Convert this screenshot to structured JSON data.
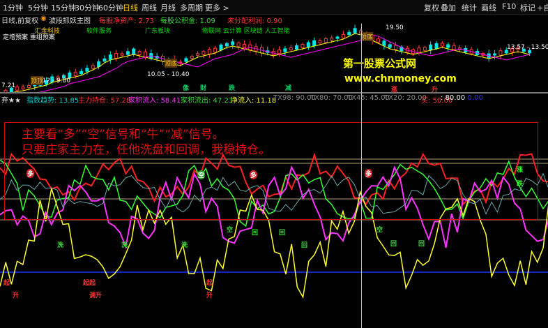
{
  "toolbar": {
    "periods": [
      "1分钟",
      "5分钟",
      "15分钟",
      "30分钟",
      "60分钟",
      "日线",
      "周线",
      "月线",
      "多周期",
      "更多 >"
    ],
    "active_period": "日线",
    "right": [
      "复权",
      "叠加",
      "统计",
      "画线",
      "F10",
      "标记",
      "+自"
    ]
  },
  "infobar": {
    "chart_label": "日线,前复权",
    "formula": "波段抓妖主图",
    "stats": [
      {
        "text": "每股净资产: 2.73",
        "color": "#ff3333"
      },
      {
        "text": "每股公积金: 1.09",
        "color": "#33dd33"
      },
      {
        "text": "未分配利润: 0.90",
        "color": "#ff3333"
      }
    ]
  },
  "sectors": {
    "tags": [
      {
        "text": "汇金科技",
        "color": "#ffcc00"
      },
      {
        "text": "软件服务",
        "color": "#00dd00"
      },
      {
        "text": "广东板块",
        "color": "#00dd00"
      },
      {
        "text": "物联网 云计算 区块链 人工智能",
        "color": "#00dd00"
      }
    ],
    "line2": "定增预案 重组预案"
  },
  "price_chart": {
    "labels": [
      {
        "text": "19.50",
        "color": "#ffffff"
      },
      {
        "text": "13.57 - 13.50",
        "color": "#ffffff"
      },
      {
        "text": "10.05 - 10.40",
        "color": "#ffffff"
      },
      {
        "text": "8.12 - 9.30",
        "color": "#ffffff"
      },
      {
        "text": "7.21",
        "color": "#ffffff"
      }
    ],
    "tags": [
      "顶底",
      "顶底",
      "顶顶"
    ],
    "signals": [
      {
        "text": "像",
        "color": "#00cc66"
      },
      {
        "text": "财",
        "color": "#00cc66"
      },
      {
        "text": "跌",
        "color": "#00cc66"
      },
      {
        "text": "减",
        "color": "#00cc66"
      },
      {
        "text": "涨",
        "color": "#ff3333"
      },
      {
        "text": "升",
        "color": "#ff3333"
      }
    ]
  },
  "watermark": {
    "title": "第一股票公式网",
    "url": "www.chnmoney.com"
  },
  "indicator_bar": {
    "name": "弃★★",
    "items": [
      {
        "text": "指数趋势: 13.85",
        "color": "#00cccc"
      },
      {
        "text": "主力持仓: 57.28",
        "color": "#ff3333"
      },
      {
        "text": "家积流入: 58.41",
        "color": "#ff33ff"
      },
      {
        "text": "家积流出: 47.23",
        "color": "#33dd33"
      },
      {
        "text": "净流入: 11.18",
        "color": "#ffff33"
      },
      {
        "text": "TX98: 90.00",
        "color": "#888888"
      },
      {
        "text": "TX80: 70.00",
        "color": "#888888"
      },
      {
        "text": "TX45: 45.00",
        "color": "#888888"
      },
      {
        "text": "TX20: 20.00",
        "color": "#888888"
      },
      {
        "text": "买: 50.00",
        "color": "#ff3333"
      },
      {
        "text": ": 80.00",
        "color": "#ffffff"
      },
      {
        "text": ": 0.00",
        "color": "#3333ff"
      }
    ]
  },
  "notice": {
    "line1": "主要看“多”“空”信号和“牛”“减”信号。",
    "line2": "只要庄家主力在，任他洗盘和回调，我稳持仓。"
  },
  "lower_labels": {
    "red": [
      "起",
      "升",
      "起起",
      "调升",
      "起",
      "升"
    ],
    "green": [
      "洗",
      "洗",
      "洗",
      "空",
      "回",
      "回",
      "回",
      "空",
      "回",
      "回"
    ],
    "signals": [
      "多",
      "空",
      "多",
      "多",
      "涨",
      "跌"
    ]
  },
  "colors": {
    "up": "#ff3b3b",
    "down": "#00e5e5",
    "ma1": "#ffff00",
    "ma2": "#ff00ff",
    "main_red": "#ff2020",
    "main_green": "#33ff33",
    "main_magenta": "#ff33ff",
    "main_yellow": "#ffff33",
    "blue_line": "#2030ff",
    "grid": "#b0a070"
  }
}
